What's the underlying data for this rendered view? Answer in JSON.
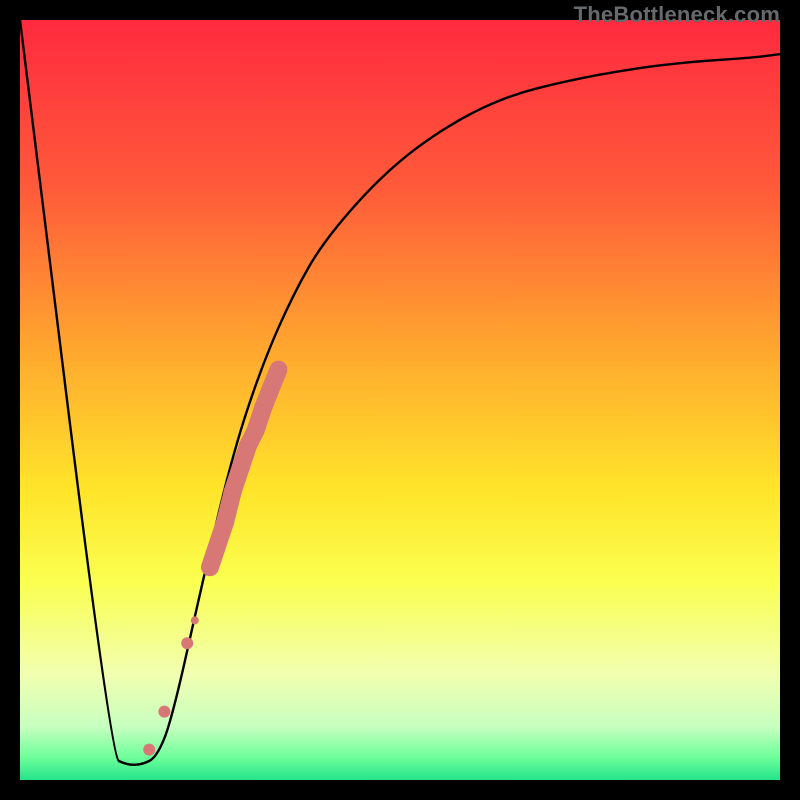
{
  "watermark": {
    "text": "TheBottleneck.com"
  },
  "chart_data": {
    "type": "line",
    "title": "",
    "xlabel": "",
    "ylabel": "",
    "xlim": [
      0,
      100
    ],
    "ylim": [
      0,
      100
    ],
    "grid": false,
    "legend": false,
    "series": [
      {
        "name": "bottleneck-curve",
        "x": [
          0,
          12,
          14,
          16,
          18,
          20,
          24,
          28,
          32,
          36,
          40,
          48,
          56,
          64,
          72,
          80,
          88,
          96,
          100
        ],
        "y": [
          100,
          3,
          2,
          2,
          3,
          8,
          26,
          43,
          55,
          64,
          71,
          80,
          86,
          90,
          92,
          93.5,
          94.5,
          95,
          95.5
        ]
      }
    ],
    "segment_band": {
      "name": "highlighted-range",
      "color": "#d77876",
      "x": [
        17,
        19,
        22,
        23,
        25,
        27,
        28,
        29,
        30,
        31,
        32,
        34
      ],
      "y": [
        4,
        9,
        18,
        21,
        28,
        34,
        38,
        41,
        44,
        46,
        49,
        54
      ],
      "radius": [
        6,
        6,
        6,
        4,
        7,
        9,
        9,
        9,
        9,
        9,
        9,
        8
      ]
    },
    "gradient_stops": [
      {
        "offset": 0.0,
        "color": "#ff2a3f"
      },
      {
        "offset": 0.22,
        "color": "#ff5a3a"
      },
      {
        "offset": 0.45,
        "color": "#ffad2e"
      },
      {
        "offset": 0.62,
        "color": "#ffe52a"
      },
      {
        "offset": 0.74,
        "color": "#faff50"
      },
      {
        "offset": 0.86,
        "color": "#f2ffb0"
      },
      {
        "offset": 0.93,
        "color": "#c7ffc0"
      },
      {
        "offset": 0.97,
        "color": "#6eff9a"
      },
      {
        "offset": 1.0,
        "color": "#26e38b"
      }
    ]
  }
}
